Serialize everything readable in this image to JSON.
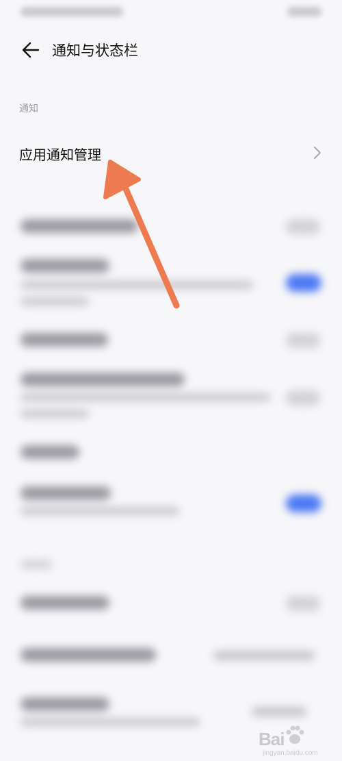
{
  "header": {
    "title": "通知与状态栏",
    "back_icon": "back-arrow-icon"
  },
  "sections": {
    "notifications": {
      "label": "通知",
      "item": {
        "label": "应用通知管理",
        "icon": "chevron-right-icon"
      }
    }
  },
  "watermark": {
    "text": "Bai",
    "site": "jingyan.baidu.com",
    "icon": "baidu-paw-icon"
  },
  "colors": {
    "annotation_arrow": "#ee7a50",
    "toggle_on": "#4d79f2"
  }
}
